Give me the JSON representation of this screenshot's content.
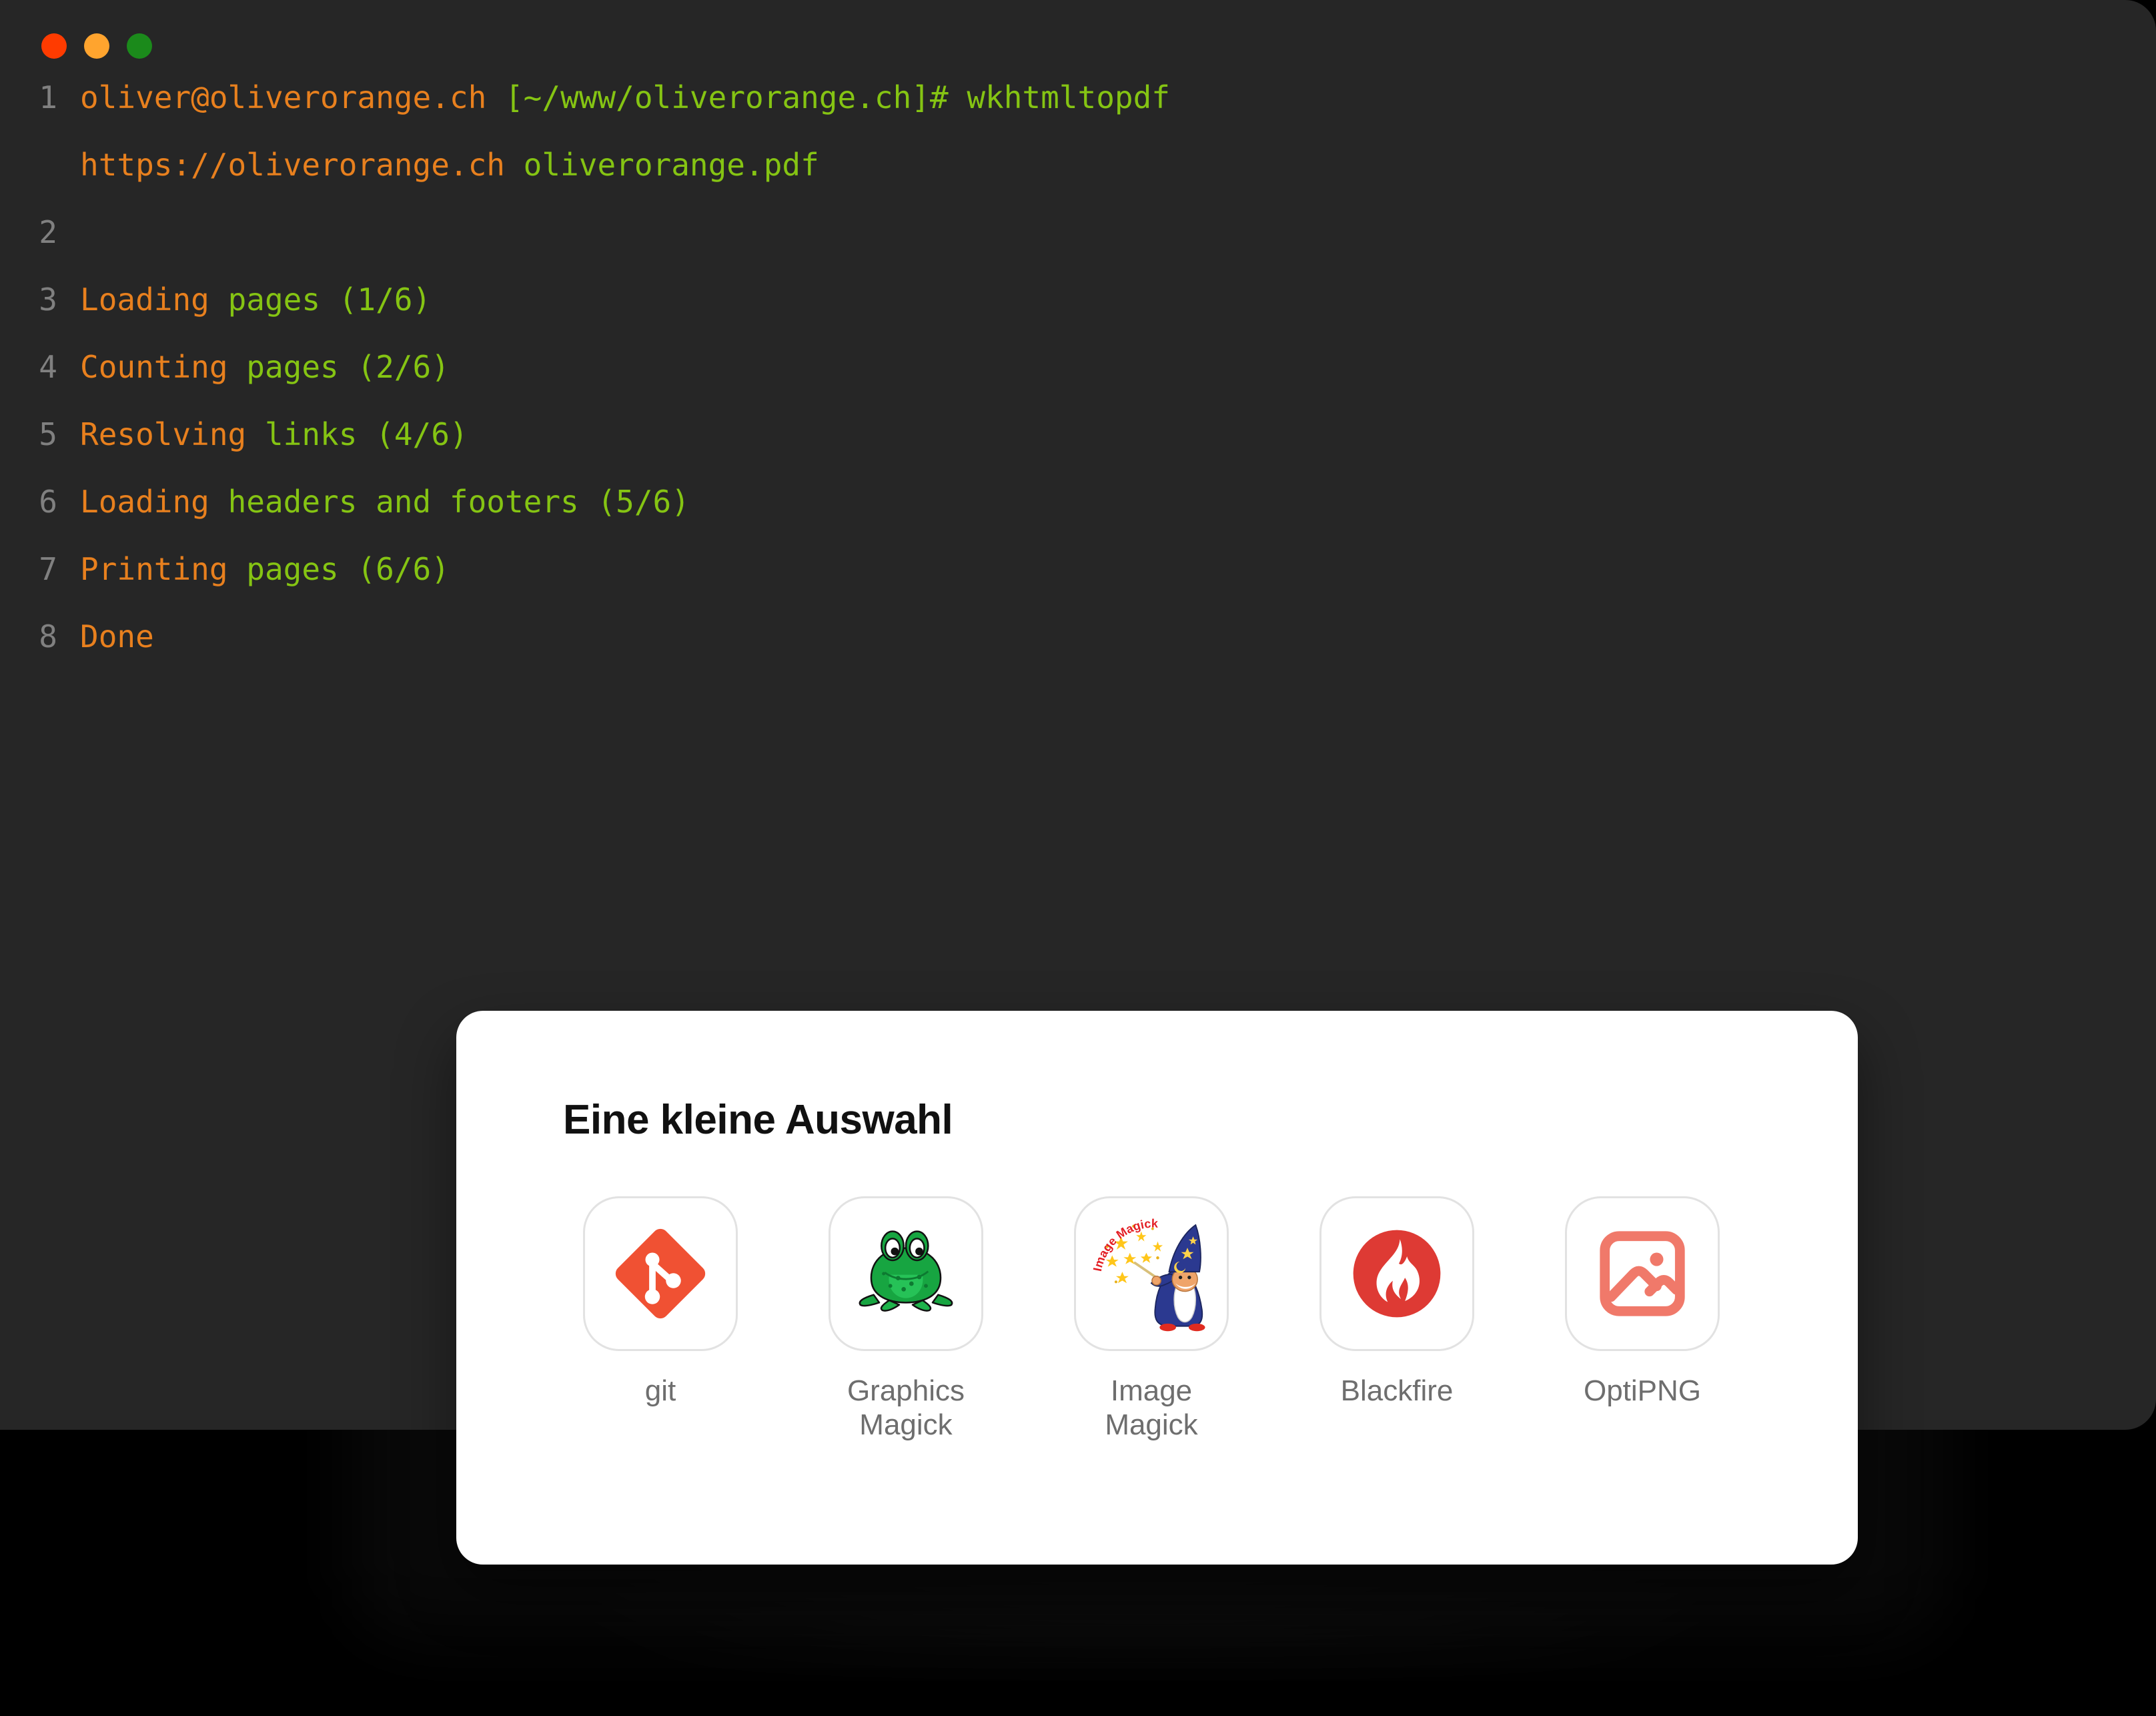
{
  "window": {
    "traffic_lights": [
      {
        "name": "close",
        "color": "#FF3B00"
      },
      {
        "name": "minimize",
        "color": "#FFA42E"
      },
      {
        "name": "maximize",
        "color": "#1B8A1B"
      }
    ]
  },
  "terminal": {
    "colors": {
      "background": "#262626",
      "line_number": "#808080",
      "orange": "#E8801E",
      "green": "#85C413"
    },
    "lines": [
      {
        "number": "1",
        "segments": [
          {
            "text": "oliver@oliverorange.ch ",
            "color": "orange"
          },
          {
            "text": "[~/www/oliverorange.ch]# wkhtmltopdf",
            "color": "green"
          }
        ],
        "wrapped": [
          {
            "text": "https://oliverorange.ch ",
            "color": "orange"
          },
          {
            "text": "oliverorange.pdf",
            "color": "green"
          }
        ]
      },
      {
        "number": "2",
        "segments": []
      },
      {
        "number": "3",
        "segments": [
          {
            "text": "Loading ",
            "color": "orange"
          },
          {
            "text": "pages (1/6)",
            "color": "green"
          }
        ]
      },
      {
        "number": "4",
        "segments": [
          {
            "text": "Counting ",
            "color": "orange"
          },
          {
            "text": "pages (2/6)",
            "color": "green"
          }
        ]
      },
      {
        "number": "5",
        "segments": [
          {
            "text": "Resolving ",
            "color": "orange"
          },
          {
            "text": "links (4/6)",
            "color": "green"
          }
        ]
      },
      {
        "number": "6",
        "segments": [
          {
            "text": "Loading ",
            "color": "orange"
          },
          {
            "text": "headers and footers (5/6)",
            "color": "green"
          }
        ]
      },
      {
        "number": "7",
        "segments": [
          {
            "text": "Printing ",
            "color": "orange"
          },
          {
            "text": "pages (6/6)",
            "color": "green"
          }
        ]
      },
      {
        "number": "8",
        "segments": [
          {
            "text": "Done",
            "color": "orange"
          }
        ]
      }
    ]
  },
  "card": {
    "title": "Eine kleine Auswahl",
    "label_color": "#6E6E6E",
    "tools": [
      {
        "label": "git",
        "icon": "git-logo-icon",
        "accent": "#F05133"
      },
      {
        "label": "Graphics\nMagick",
        "icon": "graphicsmagick-frog-icon",
        "accent": "#17A541"
      },
      {
        "label": "Image\nMagick",
        "icon": "imagemagick-wizard-icon",
        "accent": "#2B3990",
        "wizard_text": "Image Magick"
      },
      {
        "label": "Blackfire",
        "icon": "blackfire-flame-icon",
        "accent": "#DE3A34"
      },
      {
        "label": "OptiPNG",
        "icon": "optipng-image-icon",
        "accent": "#F0796A"
      }
    ]
  }
}
